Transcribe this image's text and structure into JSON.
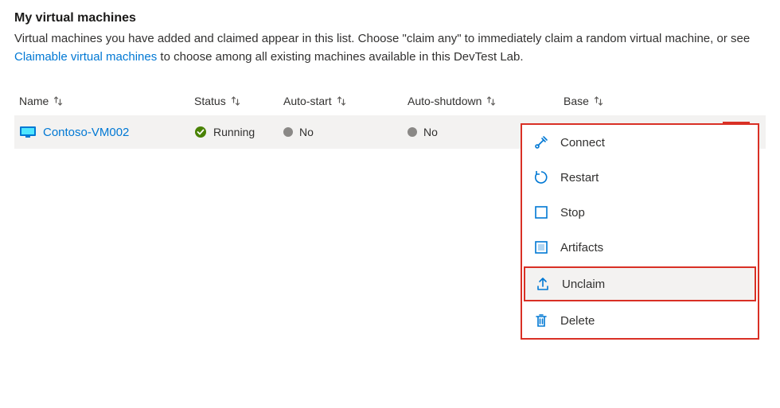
{
  "header": {
    "title": "My virtual machines",
    "description_pre": "Virtual machines you have added and claimed appear in this list. Choose \"claim any\" to immediately claim a random virtual machine, or see ",
    "description_link": "Claimable virtual machines",
    "description_post": " to choose among all existing machines available in this DevTest Lab."
  },
  "columns": {
    "name": "Name",
    "status": "Status",
    "autostart": "Auto-start",
    "autoshutdown": "Auto-shutdown",
    "base": "Base"
  },
  "rows": [
    {
      "name": "Contoso-VM002",
      "status": "Running",
      "autostart": "No",
      "autoshutdown": "No",
      "base": ""
    }
  ],
  "menu": {
    "connect": "Connect",
    "restart": "Restart",
    "stop": "Stop",
    "artifacts": "Artifacts",
    "unclaim": "Unclaim",
    "delete": "Delete"
  }
}
